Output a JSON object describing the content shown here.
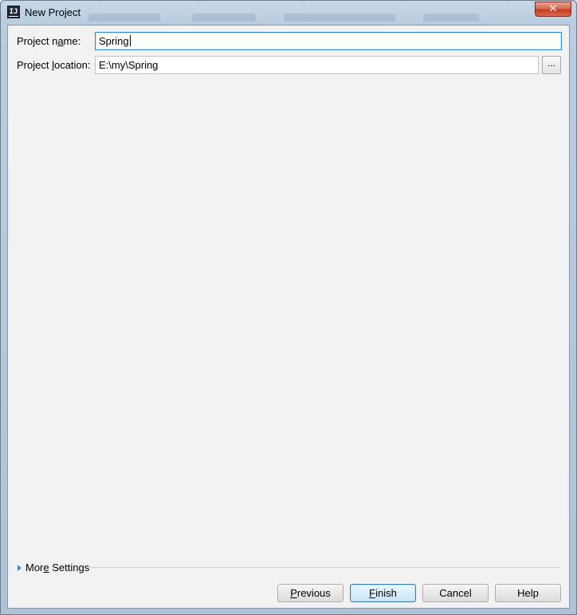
{
  "window": {
    "title": "New Project",
    "app_icon": "intellij-icon",
    "close_label": "✕"
  },
  "form": {
    "name_label_prefix": "Project n",
    "name_label_mnemonic": "a",
    "name_label_suffix": "me:",
    "name_value": "Spring",
    "location_label_prefix": "Project ",
    "location_label_mnemonic": "l",
    "location_label_suffix": "ocation:",
    "location_value": "E:\\my\\Spring",
    "browse_label": "..."
  },
  "more_settings": {
    "label_prefix": "Mor",
    "label_mnemonic": "e",
    "label_suffix": " Settings",
    "icon": "triangle-right-icon"
  },
  "buttons": {
    "previous_mnemonic": "P",
    "previous_rest": "revious",
    "finish_mnemonic": "F",
    "finish_rest": "inish",
    "cancel": "Cancel",
    "help": "Help"
  }
}
